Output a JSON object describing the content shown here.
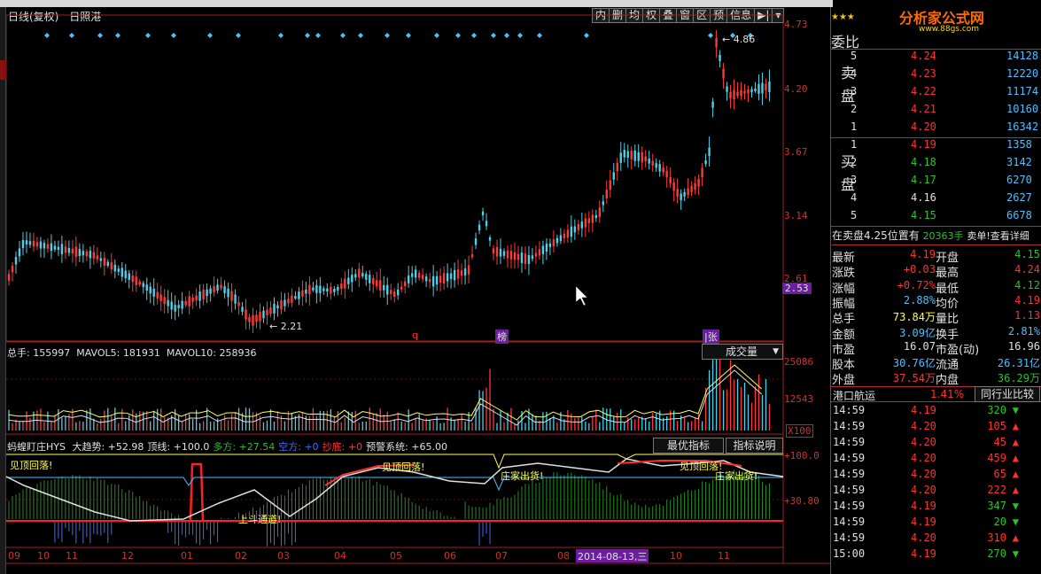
{
  "main": {
    "title": "日线(复权)",
    "stock": "日照港",
    "toolbar": [
      "内",
      "删",
      "均",
      "权",
      "叠",
      "窗",
      "区",
      "预",
      "信息",
      "▶|",
      "▾"
    ],
    "price_labels": [
      "4.73",
      "4.20",
      "3.67",
      "3.14",
      "2.61"
    ],
    "current_price_tag": "2.53",
    "high_marker": "4.86",
    "low_marker": "2.21",
    "event_tags": [
      "q",
      "榜",
      "|张"
    ]
  },
  "volume": {
    "label_total": "总手: 155997",
    "label_ma5": "MAVOL5: 181931",
    "label_ma10": "MAVOL10: 258936",
    "selector": "成交量",
    "axis": [
      "25086",
      "12543",
      "X100"
    ]
  },
  "indicator": {
    "name": "蚂蝗盯庄HYS",
    "items": [
      {
        "text": "大趋势: +52.98",
        "color": "#e0e0e0"
      },
      {
        "text": "顶线: +100.0",
        "color": "#e0e0e0"
      },
      {
        "text": "多方: +27.54",
        "color": "#2fbf2f"
      },
      {
        "text": "空方: +0",
        "color": "#3d6bff"
      },
      {
        "text": "抄底: +0",
        "color": "#ff3030"
      },
      {
        "text": "预警系统: +65.00",
        "color": "#e0e0e0"
      }
    ],
    "btn_best": "最优指标",
    "btn_help": "指标说明",
    "axis": [
      "+100.0",
      "+30.80"
    ],
    "annotations": [
      "见顶回落!",
      "见顶回落!",
      "庄家出货!",
      "见顶回落!",
      "庄家出货!",
      "上斗通道!"
    ]
  },
  "dates": {
    "labels": [
      "09",
      "10",
      "11",
      "12",
      "01",
      "02",
      "03",
      "04",
      "05",
      "06",
      "07",
      "08",
      "10",
      "11"
    ],
    "highlight": "2014-08-13,三"
  },
  "right": {
    "brand": "分析家公式网",
    "url": "www.88gs.com",
    "weibi": "委比",
    "sell_label": "卖盘",
    "buy_label": "买盘",
    "sell": [
      {
        "n": "5",
        "p": "4.24",
        "v": "14128"
      },
      {
        "n": "4",
        "p": "4.23",
        "v": "12220"
      },
      {
        "n": "3",
        "p": "4.22",
        "v": "11174"
      },
      {
        "n": "2",
        "p": "4.21",
        "v": "10160"
      },
      {
        "n": "1",
        "p": "4.20",
        "v": "16342"
      }
    ],
    "buy": [
      {
        "n": "1",
        "p": "4.19",
        "v": "1358"
      },
      {
        "n": "2",
        "p": "4.18",
        "v": "3142"
      },
      {
        "n": "3",
        "p": "4.17",
        "v": "6270"
      },
      {
        "n": "4",
        "p": "4.16",
        "v": "2627"
      },
      {
        "n": "5",
        "p": "4.15",
        "v": "6678"
      }
    ],
    "notice_left": "在卖盘4.25位置有",
    "notice_mid": "20363手",
    "notice_right": "卖单!查看详细",
    "quotes": [
      {
        "l1": "最新",
        "v1": "4.19",
        "c1": "#ff3030",
        "l2": "开盘",
        "v2": "4.15",
        "c2": "#2fbf2f"
      },
      {
        "l1": "涨跌",
        "v1": "+0.03",
        "c1": "#ff3030",
        "l2": "最高",
        "v2": "4.24",
        "c2": "#ff3030"
      },
      {
        "l1": "涨幅",
        "v1": "+0.72%",
        "c1": "#ff3030",
        "l2": "最低",
        "v2": "4.12",
        "c2": "#2fbf2f"
      },
      {
        "l1": "振幅",
        "v1": "2.88%",
        "c1": "#4dc0ff",
        "l2": "均价",
        "v2": "4.19",
        "c2": "#ff3030"
      },
      {
        "l1": "总手",
        "v1": "73.84万",
        "c1": "#ffff40",
        "l2": "量比",
        "v2": "1.13",
        "c2": "#ff3030"
      },
      {
        "l1": "金额",
        "v1": "3.09亿",
        "c1": "#4dc0ff",
        "l2": "换手",
        "v2": "2.81%",
        "c2": "#4dc0ff"
      },
      {
        "l1": "市盈",
        "v1": "16.07",
        "c1": "#e0e0e0",
        "l2": "市盈(动)",
        "v2": "16.96",
        "c2": "#e0e0e0"
      },
      {
        "l1": "股本",
        "v1": "30.76亿",
        "c1": "#4dc0ff",
        "l2": "流通",
        "v2": "26.31亿",
        "c2": "#4dc0ff"
      },
      {
        "l1": "外盘",
        "v1": "37.54万",
        "c1": "#ff3030",
        "l2": "内盘",
        "v2": "36.29万",
        "c2": "#2fbf2f"
      }
    ],
    "sector_name": "港口航运",
    "sector_pct": "1.41%",
    "sector_btn": "同行业比较",
    "trades": [
      {
        "t": "14:59",
        "p": "4.19",
        "v": "320",
        "d": "down"
      },
      {
        "t": "14:59",
        "p": "4.20",
        "v": "105",
        "d": "up"
      },
      {
        "t": "14:59",
        "p": "4.20",
        "v": "45",
        "d": "up"
      },
      {
        "t": "14:59",
        "p": "4.20",
        "v": "459",
        "d": "up"
      },
      {
        "t": "14:59",
        "p": "4.20",
        "v": "65",
        "d": "up"
      },
      {
        "t": "14:59",
        "p": "4.20",
        "v": "222",
        "d": "up"
      },
      {
        "t": "14:59",
        "p": "4.19",
        "v": "347",
        "d": "down"
      },
      {
        "t": "14:59",
        "p": "4.19",
        "v": "20",
        "d": "down"
      },
      {
        "t": "14:59",
        "p": "4.20",
        "v": "310",
        "d": "up"
      },
      {
        "t": "15:00",
        "p": "4.19",
        "v": "270",
        "d": "down"
      }
    ]
  }
}
